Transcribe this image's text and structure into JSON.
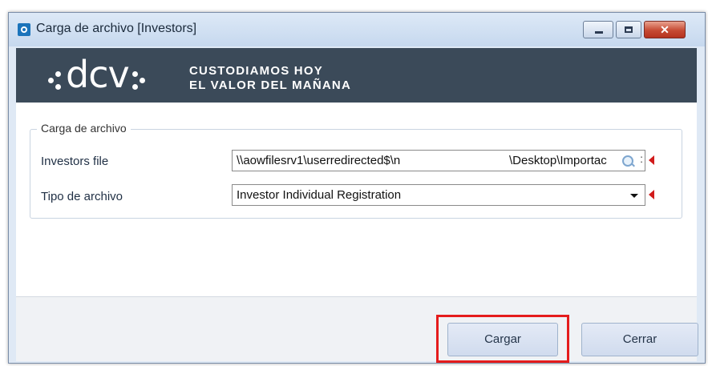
{
  "window": {
    "title": "Carga de archivo [Investors]",
    "close_symbol": "✕"
  },
  "banner": {
    "logo_text": "dcv",
    "slogan_line1": "CUSTODIAMOS HOY",
    "slogan_line2": "EL VALOR DEL MAÑANA"
  },
  "form": {
    "group_title": "Carga de archivo",
    "investors_file": {
      "label": "Investors file",
      "value_part1": "\\\\aowfilesrv1\\userredirected$\\n",
      "value_part2": "\\Desktop\\Importac",
      "browse_dots": ":"
    },
    "file_type": {
      "label": "Tipo de archivo",
      "selected": "Investor Individual Registration"
    }
  },
  "buttons": {
    "load": "Cargar",
    "close": "Cerrar"
  },
  "colors": {
    "banner_bg": "#3b4a59",
    "required_marker": "#d11b1b",
    "highlight": "#e51c1c"
  },
  "icons": [
    "app-icon",
    "minimize-icon",
    "maximize-icon",
    "close-icon",
    "search-icon",
    "dropdown-arrow-icon",
    "required-marker-icon"
  ]
}
